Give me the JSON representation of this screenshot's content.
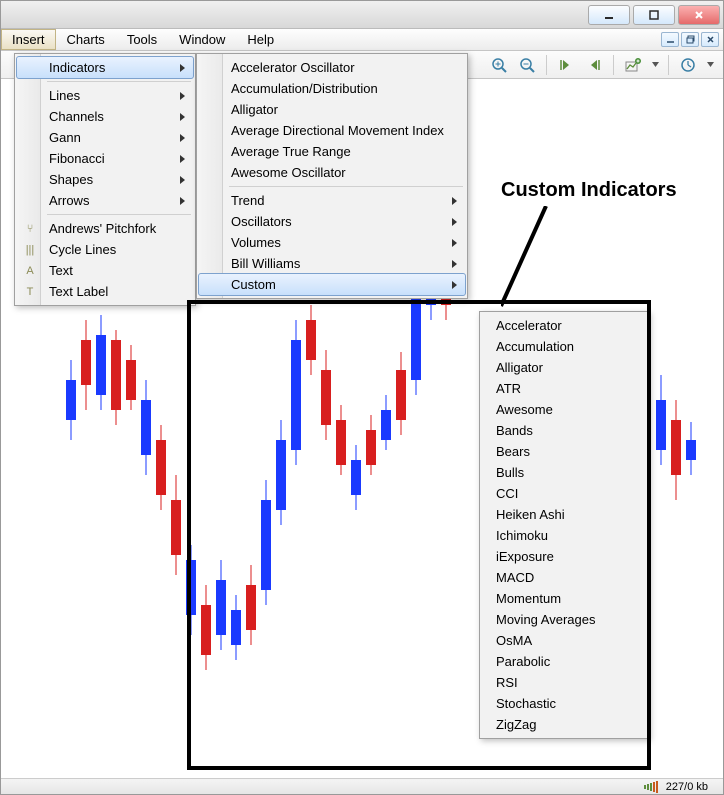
{
  "menubar": {
    "insert": "Insert",
    "charts": "Charts",
    "tools": "Tools",
    "window": "Window",
    "help": "Help"
  },
  "insert_menu": {
    "indicators": "Indicators",
    "lines": "Lines",
    "channels": "Channels",
    "gann": "Gann",
    "fibonacci": "Fibonacci",
    "shapes": "Shapes",
    "arrows": "Arrows",
    "andrews_pitchfork": "Andrews' Pitchfork",
    "cycle_lines": "Cycle Lines",
    "text": "Text",
    "text_label": "Text Label"
  },
  "indicators_menu": {
    "accelerator_oscillator": "Accelerator Oscillator",
    "accumulation_distribution": "Accumulation/Distribution",
    "alligator": "Alligator",
    "adx": "Average Directional Movement Index",
    "atr": "Average True Range",
    "awesome_oscillator": "Awesome Oscillator",
    "trend": "Trend",
    "oscillators": "Oscillators",
    "volumes": "Volumes",
    "bill_williams": "Bill Williams",
    "custom": "Custom"
  },
  "custom_menu": {
    "accelerator": "Accelerator",
    "accumulation": "Accumulation",
    "alligator": "Alligator",
    "atr": "ATR",
    "awesome": "Awesome",
    "bands": "Bands",
    "bears": "Bears",
    "bulls": "Bulls",
    "cci": "CCI",
    "heiken_ashi": "Heiken Ashi",
    "ichimoku": "Ichimoku",
    "iexposure": "iExposure",
    "macd": "MACD",
    "momentum": "Momentum",
    "moving_averages": "Moving Averages",
    "osma": "OsMA",
    "parabolic": "Parabolic",
    "rsi": "RSI",
    "stochastic": "Stochastic",
    "zigzag": "ZigZag"
  },
  "annotation": "Custom Indicators",
  "status": {
    "data": "227/0 kb"
  },
  "colors": {
    "candle_up": "#1a3aff",
    "candle_down": "#d81f1f"
  }
}
